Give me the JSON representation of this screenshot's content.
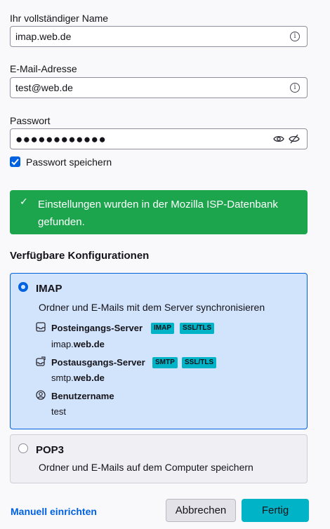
{
  "form": {
    "name_label": "Ihr vollständiger Name",
    "name_value": "imap.web.de",
    "email_label": "E-Mail-Adresse",
    "email_value": "test@web.de",
    "password_label": "Passwort",
    "password_value": "●●●●●●●●●●●●",
    "remember_label": "Passwort speichern",
    "remember_checked": true
  },
  "banner": {
    "icon": "check-icon",
    "text": "Einstellungen wurden in der Mozilla ISP-Datenbank gefunden."
  },
  "configs": {
    "heading": "Verfügbare Konfigurationen",
    "imap": {
      "title": "IMAP",
      "desc": "Ordner und E-Mails mit dem Server synchronisieren",
      "incoming_label": "Posteingangs-Server",
      "incoming_badges": [
        "IMAP",
        "SSL/TLS"
      ],
      "incoming_host_prefix": "imap.",
      "incoming_host_domain": "web.de",
      "outgoing_label": "Postausgangs-Server",
      "outgoing_badges": [
        "SMTP",
        "SSL/TLS"
      ],
      "outgoing_host_prefix": "smtp.",
      "outgoing_host_domain": "web.de",
      "user_label": "Benutzername",
      "user_value": "test"
    },
    "pop3": {
      "title": "POP3",
      "desc": "Ordner und E-Mails auf dem Computer speichern"
    }
  },
  "footer": {
    "manual_link": "Manuell einrichten",
    "cancel_label": "Abbrechen",
    "done_label": "Fertig"
  },
  "colors": {
    "accent": "#0061e0",
    "success": "#1ca54d",
    "teal": "#00b3c6",
    "selected_bg": "#d2e3fc"
  }
}
